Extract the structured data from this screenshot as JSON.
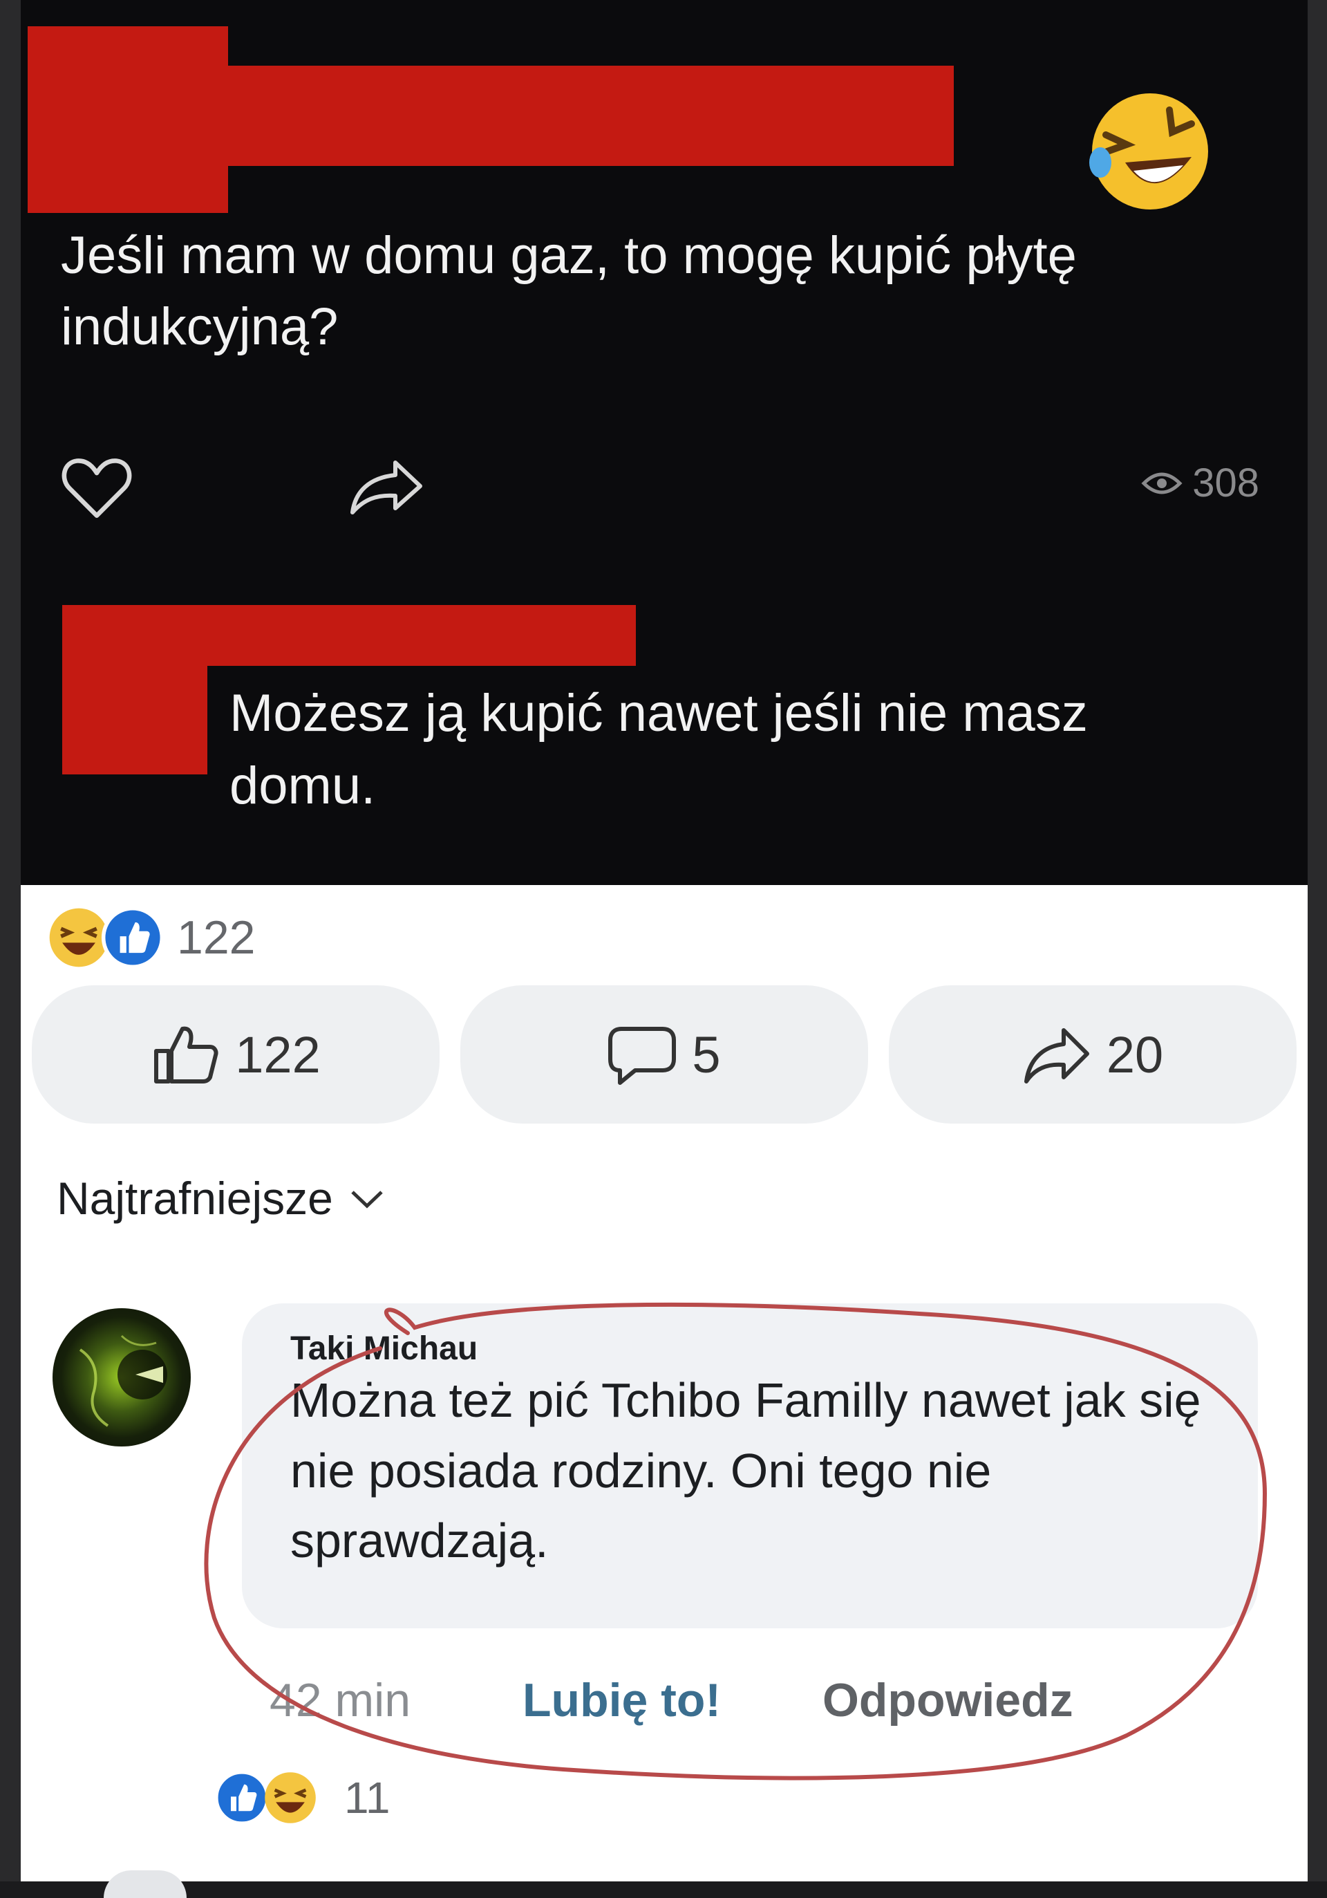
{
  "post": {
    "text": "Jeśli mam w domu gaz, to mogę kupić płytę indukcyjną?",
    "views": "308"
  },
  "reply": {
    "text": "Możesz ją kupić nawet jeśli nie masz domu."
  },
  "facebook": {
    "reaction_total": "122",
    "like_count": "122",
    "comment_count": "5",
    "share_count": "20",
    "sort_label": "Najtrafniejsze",
    "comment": {
      "author": "Taki Michau",
      "text": "Można też pić Tchibo Familly nawet jak się nie posiada rodziny. Oni tego nie sprawdzają.",
      "time": "42 min",
      "like_label": "Lubię to!",
      "reply_label": "Odpowiedz",
      "reaction_count": "11"
    }
  },
  "colors": {
    "redaction": "#c41a12",
    "like_blue": "#3b6e8f",
    "annotation": "#b84a4a"
  }
}
